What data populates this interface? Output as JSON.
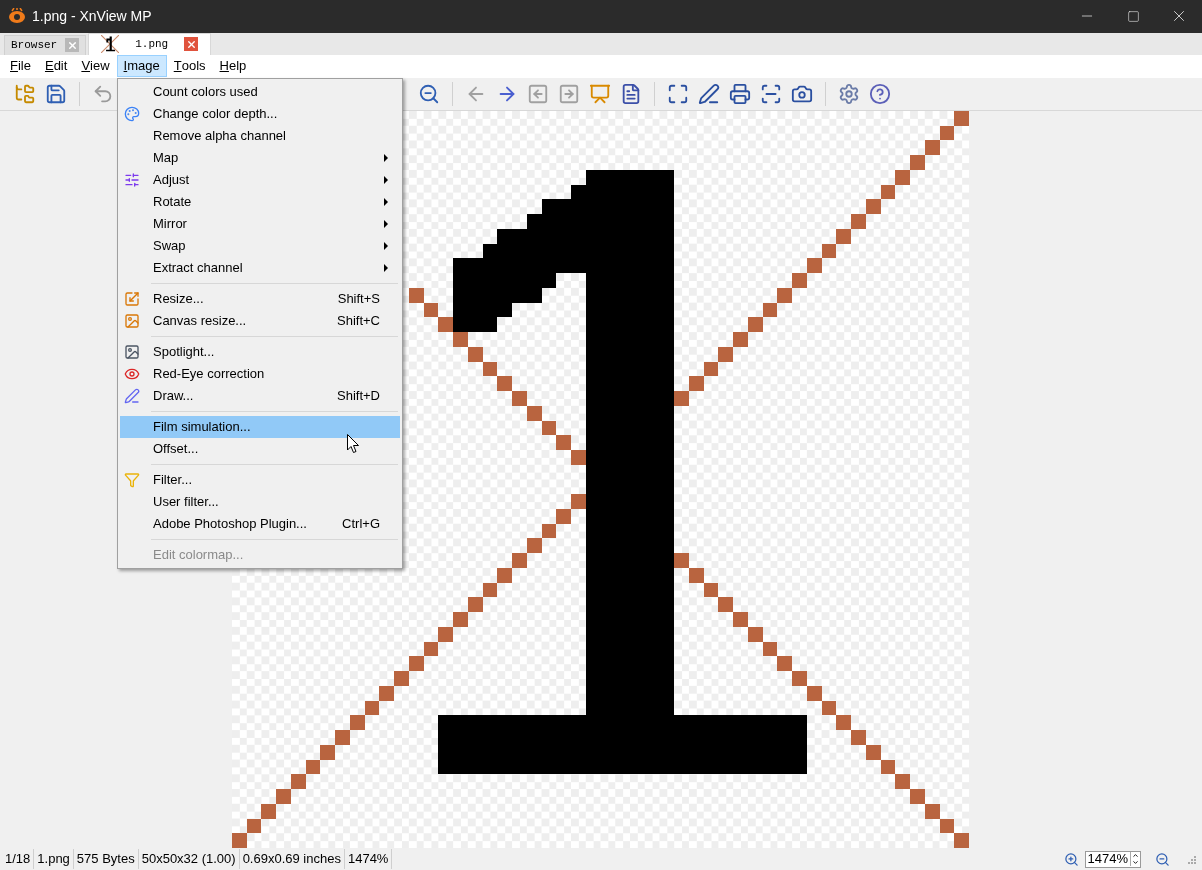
{
  "window": {
    "title": "1.png - XnView MP"
  },
  "tabs": [
    {
      "label": "Browser",
      "selected": false,
      "kind": "browser"
    },
    {
      "label": "1.png",
      "selected": true,
      "kind": "image"
    }
  ],
  "menu_bar": [
    {
      "label": "File",
      "selected": false
    },
    {
      "label": "Edit",
      "selected": false
    },
    {
      "label": "View",
      "selected": false
    },
    {
      "label": "Image",
      "selected": true
    },
    {
      "label": "Tools",
      "selected": false
    },
    {
      "label": "Help",
      "selected": false
    }
  ],
  "image_menu": [
    {
      "kind": "item",
      "label": "Count colors used",
      "selected": false,
      "disabled": false
    },
    {
      "kind": "item",
      "label": "Change color depth...",
      "selected": false,
      "disabled": false
    },
    {
      "kind": "item",
      "label": "Remove alpha channel",
      "selected": false,
      "disabled": false
    },
    {
      "kind": "submenu",
      "label": "Map",
      "selected": false,
      "disabled": false
    },
    {
      "kind": "submenu",
      "label": "Adjust",
      "selected": false,
      "disabled": false
    },
    {
      "kind": "submenu",
      "label": "Rotate",
      "selected": false,
      "disabled": false
    },
    {
      "kind": "submenu",
      "label": "Mirror",
      "selected": false,
      "disabled": false
    },
    {
      "kind": "submenu",
      "label": "Swap",
      "selected": false,
      "disabled": false
    },
    {
      "kind": "submenu",
      "label": "Extract channel",
      "selected": false,
      "disabled": false
    },
    {
      "kind": "separator"
    },
    {
      "kind": "item",
      "label": "Resize...",
      "shortcut": "Shift+S",
      "selected": false,
      "disabled": false
    },
    {
      "kind": "item",
      "label": "Canvas resize...",
      "shortcut": "Shift+C",
      "selected": false,
      "disabled": false
    },
    {
      "kind": "separator"
    },
    {
      "kind": "item",
      "label": "Spotlight...",
      "selected": false,
      "disabled": false
    },
    {
      "kind": "item",
      "label": "Red-Eye correction",
      "selected": false,
      "disabled": false
    },
    {
      "kind": "item",
      "label": "Draw...",
      "shortcut": "Shift+D",
      "selected": false,
      "disabled": false
    },
    {
      "kind": "separator"
    },
    {
      "kind": "item",
      "label": "Film simulation...",
      "selected": true,
      "disabled": false
    },
    {
      "kind": "item",
      "label": "Offset...",
      "selected": false,
      "disabled": false
    },
    {
      "kind": "separator"
    },
    {
      "kind": "item",
      "label": "Filter...",
      "selected": false,
      "disabled": false
    },
    {
      "kind": "item",
      "label": "User filter...",
      "selected": false,
      "disabled": false
    },
    {
      "kind": "item",
      "label": "Adobe Photoshop Plugin...",
      "shortcut": "Ctrl+G",
      "selected": false,
      "disabled": false
    },
    {
      "kind": "separator"
    },
    {
      "kind": "item",
      "label": "Edit colormap...",
      "selected": false,
      "disabled": true
    }
  ],
  "status_bar": {
    "fields": [
      "1/18",
      "1.png",
      "575 Bytes",
      "50x50x32 (1.00)",
      "0.69x0.69 inches",
      "1474%"
    ],
    "zoom": "1474%"
  }
}
